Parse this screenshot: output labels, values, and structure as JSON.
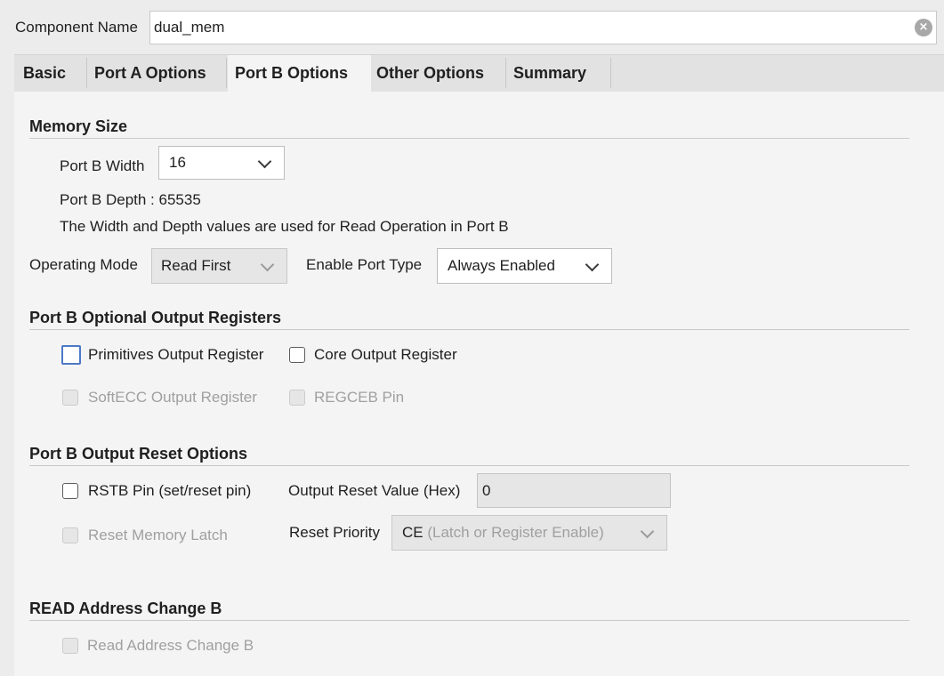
{
  "component": {
    "label": "Component Name",
    "value": "dual_mem"
  },
  "tabs": [
    {
      "label": "Basic"
    },
    {
      "label": "Port A Options"
    },
    {
      "label": "Port B Options"
    },
    {
      "label": "Other Options"
    },
    {
      "label": "Summary"
    }
  ],
  "active_tab": "Port B Options",
  "memory_size": {
    "title": "Memory Size",
    "width_label": "Port B Width",
    "width_value": "16",
    "depth_text": "Port B Depth : 65535",
    "note": "The Width and Depth values are used for Read Operation in Port B",
    "op_mode_label": "Operating Mode",
    "op_mode_value": "Read First",
    "enable_label": "Enable Port Type",
    "enable_value": "Always Enabled"
  },
  "output_registers": {
    "title": "Port B Optional Output Registers",
    "primitives": "Primitives Output Register",
    "core": "Core Output Register",
    "softecc": "SoftECC Output Register",
    "regceb": "REGCEB Pin"
  },
  "reset_options": {
    "title": "Port B Output Reset Options",
    "rstb": "RSTB Pin (set/reset pin)",
    "reset_value_label": "Output Reset Value (Hex)",
    "reset_value": "0",
    "reset_latch": "Reset Memory Latch",
    "priority_label": "Reset Priority",
    "priority_value": "CE",
    "priority_hint": "(Latch or Register Enable)"
  },
  "read_address": {
    "title": "READ Address Change B",
    "checkbox": "Read Address Change B"
  },
  "icons": {
    "clear": "clear-circle-x-icon",
    "dropdown": "chevron-down-icon"
  },
  "colors": {
    "focus_border": "#4d78c8",
    "disabled_text": "#a0a0a0"
  }
}
